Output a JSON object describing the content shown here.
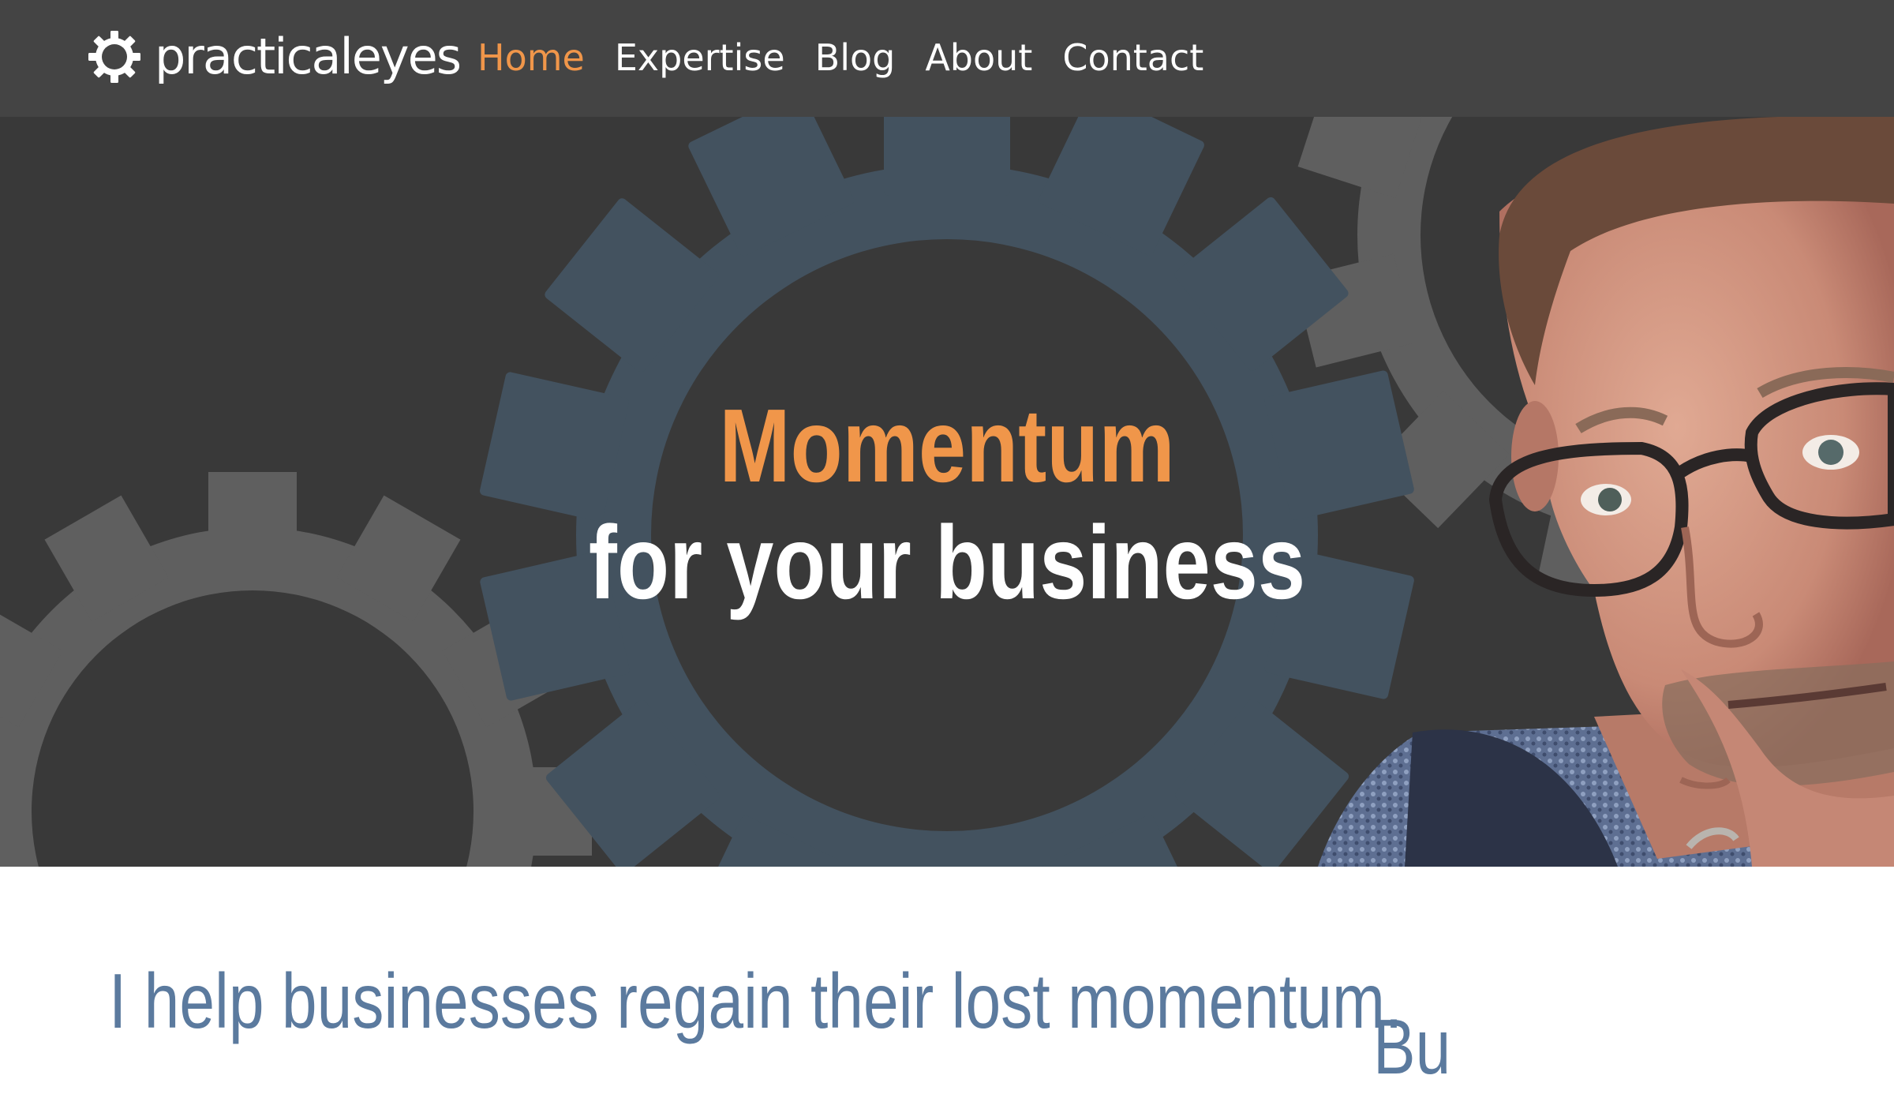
{
  "brand": {
    "logo_text": "practicaleyes",
    "logo_icon": "gear-icon"
  },
  "nav": {
    "items": [
      {
        "label": "Home",
        "active": true
      },
      {
        "label": "Expertise",
        "active": false
      },
      {
        "label": "Blog",
        "active": false
      },
      {
        "label": "About",
        "active": false
      },
      {
        "label": "Contact",
        "active": false
      }
    ]
  },
  "hero": {
    "headline_accent": "Momentum",
    "headline_prefix": "for your",
    "headline_bold": "business"
  },
  "content": {
    "intro": "I help businesses regain their lost momentum.",
    "side_heading": "Bu"
  },
  "colors": {
    "nav_bg": "#444444",
    "hero_bg": "#393939",
    "accent_orange": "#f0964a",
    "gear_blue": "#43525f",
    "gear_grey": "#5f5f5f",
    "heading_blue": "#5b7a9e"
  }
}
